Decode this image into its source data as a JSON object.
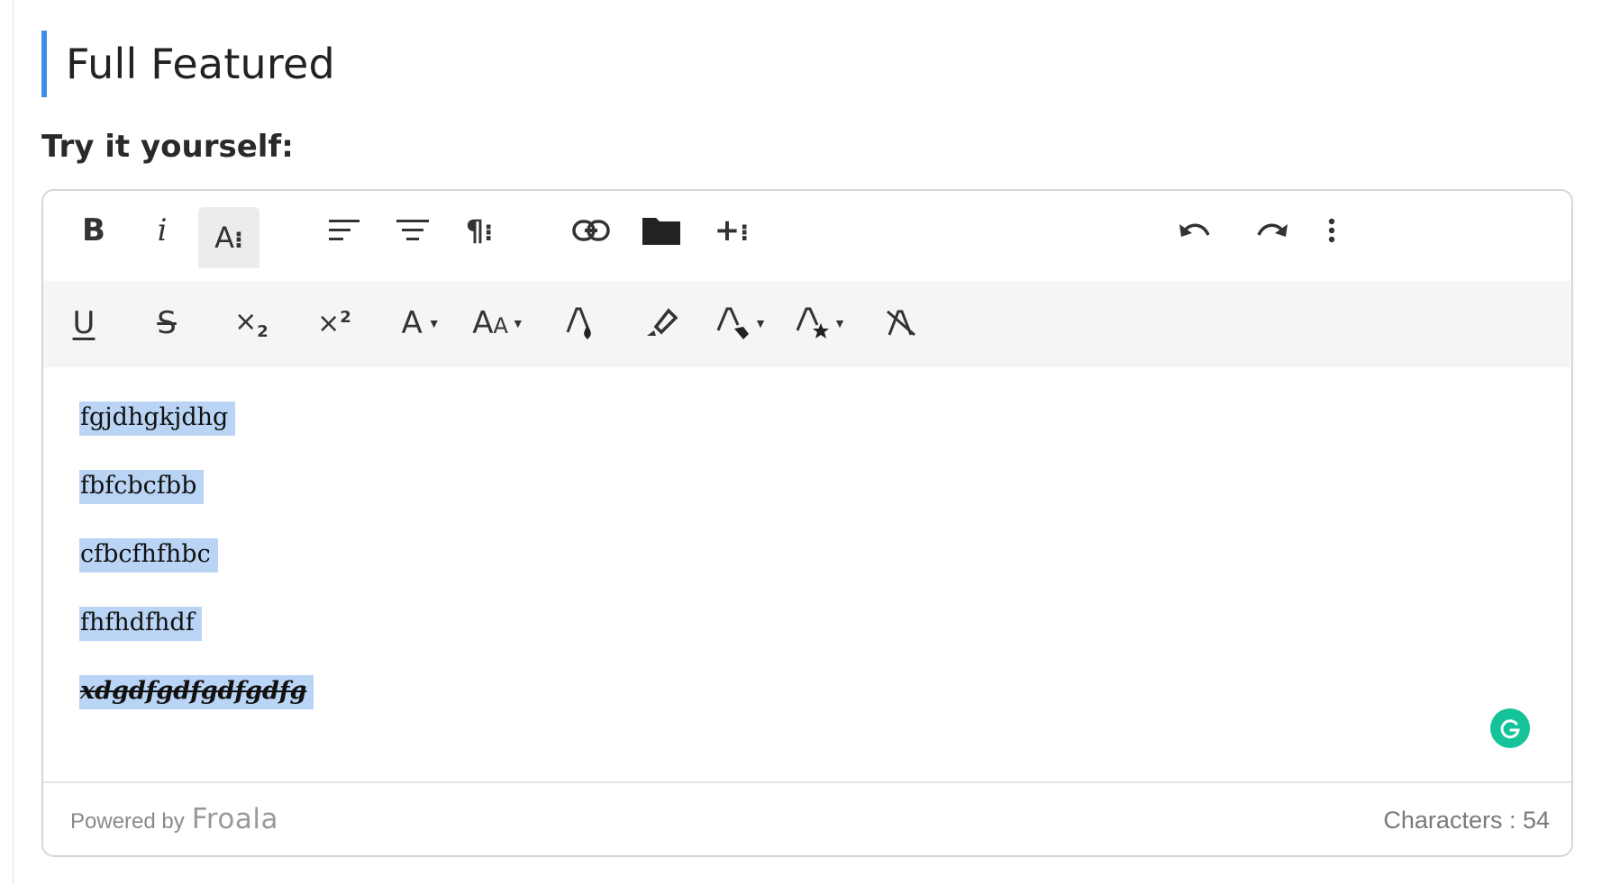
{
  "page": {
    "title": "Full Featured",
    "subtitle": "Try it yourself:"
  },
  "toolbar": {
    "row1": [
      {
        "icon": "bold-icon",
        "label": "B"
      },
      {
        "icon": "italic-icon",
        "label": "i"
      },
      {
        "icon": "text-format-menu-icon",
        "label": "A:",
        "active": true
      },
      {
        "icon": "align-left-icon"
      },
      {
        "icon": "align-center-icon"
      },
      {
        "icon": "paragraph-menu-icon"
      },
      {
        "icon": "insert-link-icon"
      },
      {
        "icon": "folder-icon"
      },
      {
        "icon": "insert-more-icon"
      },
      {
        "icon": "undo-icon"
      },
      {
        "icon": "redo-icon"
      },
      {
        "icon": "more-options-icon"
      }
    ],
    "row2": [
      {
        "icon": "underline-icon"
      },
      {
        "icon": "strikethrough-icon"
      },
      {
        "icon": "subscript-icon"
      },
      {
        "icon": "superscript-icon"
      },
      {
        "icon": "font-family-icon"
      },
      {
        "icon": "font-size-icon"
      },
      {
        "icon": "text-color-icon"
      },
      {
        "icon": "background-color-icon"
      },
      {
        "icon": "inline-class-icon"
      },
      {
        "icon": "inline-style-icon"
      },
      {
        "icon": "clear-formatting-icon"
      }
    ]
  },
  "content": {
    "paragraphs": [
      "fgjdhgkjdhg",
      "fbfcbcfbb",
      "cfbcfhfhbc",
      "fhfhdfhdf",
      "xdgdfgdfgdfgdfg"
    ]
  },
  "footer": {
    "powered_by": "Powered by",
    "brand": "Froala",
    "character_count": "Characters : 54"
  },
  "colors": {
    "accent": "#3a8ee6",
    "selection": "#b9d4f4",
    "grammarly": "#15c39a",
    "toolbar_bg": "#f5f5f5"
  }
}
